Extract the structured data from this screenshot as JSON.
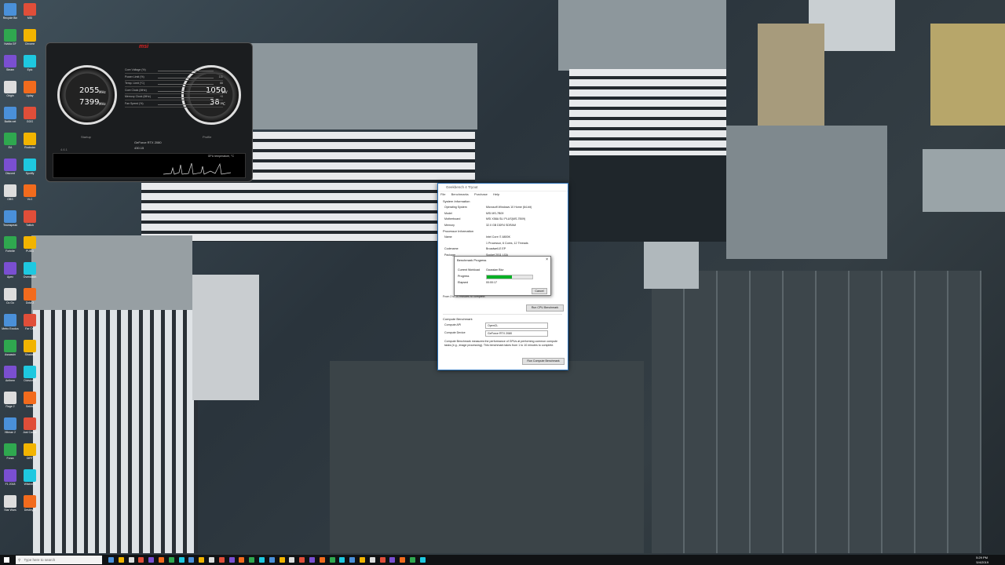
{
  "afterburner": {
    "brand": "msi",
    "gpu_clock": "2055",
    "mem_clock": "7399",
    "clock_unit": "MHz",
    "voltage": "1050",
    "voltage_unit": "mV",
    "temp": "38",
    "temp_unit": "°C",
    "sliders": [
      {
        "label": "Core Voltage (%)",
        "value": "0"
      },
      {
        "label": "Power Limit (%)",
        "value": "111"
      },
      {
        "label": "Temp. Limit (°C)",
        "value": "88"
      },
      {
        "label": "Core Clock (MHz)",
        "value": "+0"
      },
      {
        "label": "Memory Clock (MHz)",
        "value": "+0"
      },
      {
        "label": "Fan Speed (%)",
        "value": "38"
      }
    ],
    "startup": "Startup",
    "profile": "Profile",
    "graphics_card": "GeForce RTX 2080",
    "driver_version": "430.15",
    "version": "4.6.1",
    "graph_label": "GPU temperature, °C"
  },
  "geekbench": {
    "title": "Geekbench 4 Tryout",
    "menu": [
      "File",
      "Benchmarks",
      "Purchase",
      "Help"
    ],
    "system_info": {
      "heading": "System Information",
      "rows": [
        {
          "k": "Operating System",
          "v": "Microsoft Windows 10 Home (64-bit)"
        },
        {
          "k": "Model",
          "v": "MSI MS-7B09"
        },
        {
          "k": "Motherboard",
          "v": "MSI X58A SLI PLUS(MS-7B09)"
        },
        {
          "k": "Memory",
          "v": "32.0 GB DDR4 SDRAM"
        }
      ]
    },
    "processor_info": {
      "heading": "Processor Information",
      "rows": [
        {
          "k": "Name",
          "v": "Intel Core i7-6800K"
        },
        {
          "k": "",
          "v": "1 Processor, 6 Cores, 12 Threads"
        },
        {
          "k": "Codename",
          "v": "Broadwell-E EP"
        },
        {
          "k": "Package",
          "v": "Socket 2011 LGA"
        }
      ]
    },
    "cpu_note": "From 2 to 20 minutes to complete.",
    "run_cpu_button": "Run CPU Benchmark",
    "compute": {
      "heading": "Compute Benchmark",
      "api_label": "Compute API",
      "api_value": "OpenCL",
      "device_label": "Compute Device",
      "device_value": "GeForce RTX 2080",
      "description": "Compute Benchmark measures the performance of GPUs at performing common compute tasks (e.g., image processing). This benchmark takes from 1 to 10 minutes to complete.",
      "run_button": "Run Compute Benchmark"
    }
  },
  "progress_dialog": {
    "title": "Benchmark Progress",
    "workload_label": "Current Workload",
    "workload_value": "Gaussian Blur",
    "progress_label": "Progress",
    "progress": 0.55,
    "elapsed_label": "Elapsed",
    "elapsed_value": "00:00:17",
    "cancel_button": "Cancel"
  },
  "taskbar": {
    "search_placeholder": "Type here to search",
    "clock_time": "5:29 PM",
    "clock_date": "5/4/2019"
  },
  "desktop_icons": [
    "Recycle Bin",
    "MSI",
    "Nvidia GF",
    "Chrome",
    "Steam",
    "Epic",
    "Origin",
    "Uplay",
    "Battle.net",
    "GOG",
    "EA",
    "Rockstar",
    "Discord",
    "Spotify",
    "OBS",
    "VLC",
    "Teamspeak",
    "Twitch",
    "Fortnite",
    "PUBG",
    "Apex",
    "Overwatch",
    "Cs Go",
    "Dota 2",
    "Metro Exodus",
    "Far Cry",
    "Assassin",
    "Shadow",
    "Anthem",
    "Division 2",
    "Rage 2",
    "Sekiro",
    "Hitman 2",
    "Just Cause",
    "Forza",
    "DiRT",
    "F1 2018",
    "Witcher 3",
    "Star Wars",
    "Destiny 2"
  ]
}
